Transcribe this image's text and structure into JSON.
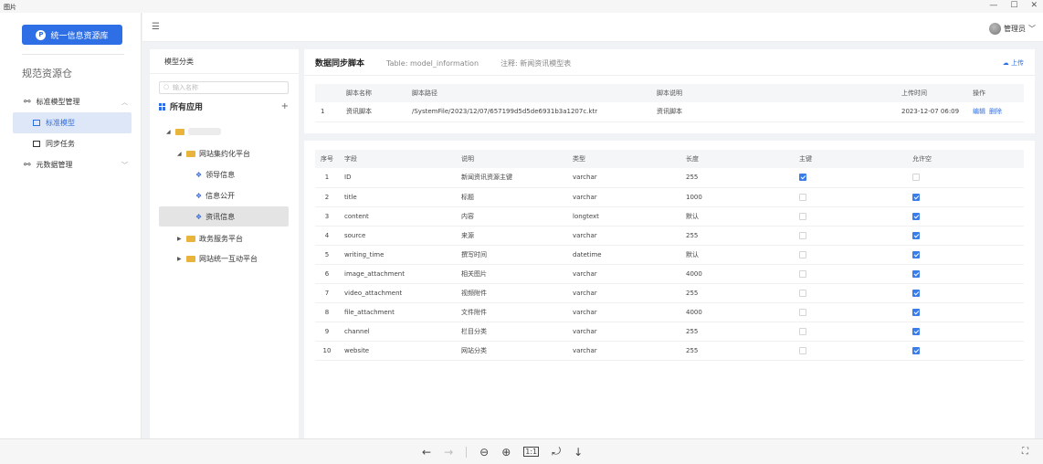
{
  "viewer": {
    "title": "图片",
    "minimize": "—",
    "maximize": "☐",
    "close": "✕",
    "tools": [
      "←",
      "→",
      "⊖",
      "⊕",
      "1:1",
      "⤾",
      "↓"
    ],
    "fit": "⛶"
  },
  "sidebar": {
    "brand_button": "统一信息资源库",
    "section_title": "规范资源仓",
    "menu": [
      {
        "label": "标准模型管理",
        "caret": "︿"
      },
      {
        "label": "标准模型"
      },
      {
        "label": "同步任务"
      },
      {
        "label": "元数据管理",
        "caret": "﹀"
      }
    ]
  },
  "topbar": {
    "menu_icon": "☰",
    "user": "管理员",
    "user_caret": "﹀"
  },
  "tree": {
    "title": "模型分类",
    "search_placeholder": "输入名称",
    "root_label": "所有应用",
    "add_label": "+",
    "nodes": [
      {
        "label": "网站集约化平台"
      },
      {
        "label": "领导信息"
      },
      {
        "label": "信息公开"
      },
      {
        "label": "资讯信息"
      },
      {
        "label": "政务服务平台"
      },
      {
        "label": "网站统一互动平台"
      }
    ]
  },
  "script_panel": {
    "title": "数据同步脚本",
    "table_info": "Table: model_information",
    "note": "注释: 新闻资讯模型表",
    "upload_label": "上传",
    "headers": [
      "",
      "脚本名称",
      "脚本路径",
      "脚本说明",
      "上传时间",
      "操作"
    ],
    "rows": [
      {
        "index": "1",
        "name": "资讯脚本",
        "path": "/SystemFile/2023/12/07/657199d5d5de6931b3a1207c.ktr",
        "desc": "资讯脚本",
        "time": "2023-12-07 06:09",
        "edit": "编辑",
        "delete": "删除"
      }
    ]
  },
  "fields_table": {
    "headers": [
      "序号",
      "字段",
      "说明",
      "类型",
      "长度",
      "主键",
      "允许空"
    ],
    "rows": [
      {
        "no": "1",
        "field": "ID",
        "desc": "新闻资讯资源主键",
        "type": "varchar",
        "length": "255",
        "pk": true,
        "nullable": false
      },
      {
        "no": "2",
        "field": "title",
        "desc": "标题",
        "type": "varchar",
        "length": "1000",
        "pk": false,
        "nullable": true
      },
      {
        "no": "3",
        "field": "content",
        "desc": "内容",
        "type": "longtext",
        "length": "默认",
        "pk": false,
        "nullable": true
      },
      {
        "no": "4",
        "field": "source",
        "desc": "来源",
        "type": "varchar",
        "length": "255",
        "pk": false,
        "nullable": true
      },
      {
        "no": "5",
        "field": "writing_time",
        "desc": "撰写时间",
        "type": "datetime",
        "length": "默认",
        "pk": false,
        "nullable": true
      },
      {
        "no": "6",
        "field": "image_attachment",
        "desc": "相关图片",
        "type": "varchar",
        "length": "4000",
        "pk": false,
        "nullable": true
      },
      {
        "no": "7",
        "field": "video_attachment",
        "desc": "视频附件",
        "type": "varchar",
        "length": "255",
        "pk": false,
        "nullable": true
      },
      {
        "no": "8",
        "field": "file_attachment",
        "desc": "文件附件",
        "type": "varchar",
        "length": "4000",
        "pk": false,
        "nullable": true
      },
      {
        "no": "9",
        "field": "channel",
        "desc": "栏目分类",
        "type": "varchar",
        "length": "255",
        "pk": false,
        "nullable": true
      },
      {
        "no": "10",
        "field": "website",
        "desc": "网站分类",
        "type": "varchar",
        "length": "255",
        "pk": false,
        "nullable": true
      }
    ]
  }
}
